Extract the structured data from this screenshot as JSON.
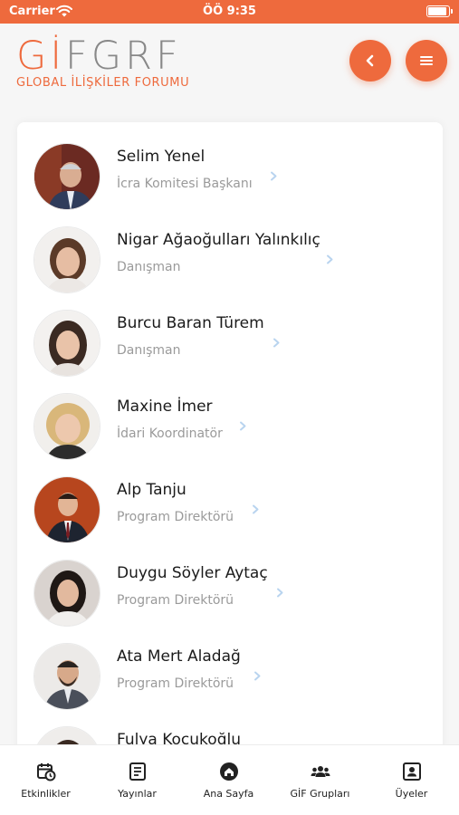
{
  "status_bar": {
    "carrier": "Carrier",
    "time": "ÖÖ 9:35"
  },
  "header": {
    "logo_main_accent": "Gİ",
    "logo_main_rest": "FGRF",
    "logo_sub": "GLOBAL İLİŞKİLER FORUMU"
  },
  "members": [
    {
      "name": "Selim Yenel",
      "title": "İcra Komitesi Başkanı"
    },
    {
      "name": "Nigar Ağaoğulları Yalınkılıç",
      "title": "Danışman"
    },
    {
      "name": "Burcu Baran Türem",
      "title": "Danışman"
    },
    {
      "name": "Maxine İmer",
      "title": "İdari Koordinatör"
    },
    {
      "name": "Alp Tanju",
      "title": "Program Direktörü"
    },
    {
      "name": "Duygu Söyler Aytaç",
      "title": "Program Direktörü"
    },
    {
      "name": "Ata Mert Aladağ",
      "title": "Program Direktörü"
    },
    {
      "name": "Fulya Kocukoğlu",
      "title": ""
    }
  ],
  "tabs": [
    {
      "label": "Etkinlikler",
      "icon": "calendar-clock-icon"
    },
    {
      "label": "Yayınlar",
      "icon": "document-icon"
    },
    {
      "label": "Ana Sayfa",
      "icon": "home-icon"
    },
    {
      "label": "GİF Grupları",
      "icon": "group-icon"
    },
    {
      "label": "Üyeler",
      "icon": "member-card-icon"
    }
  ],
  "colors": {
    "accent": "#ee6a3d",
    "chevron": "#b9d4ef"
  }
}
